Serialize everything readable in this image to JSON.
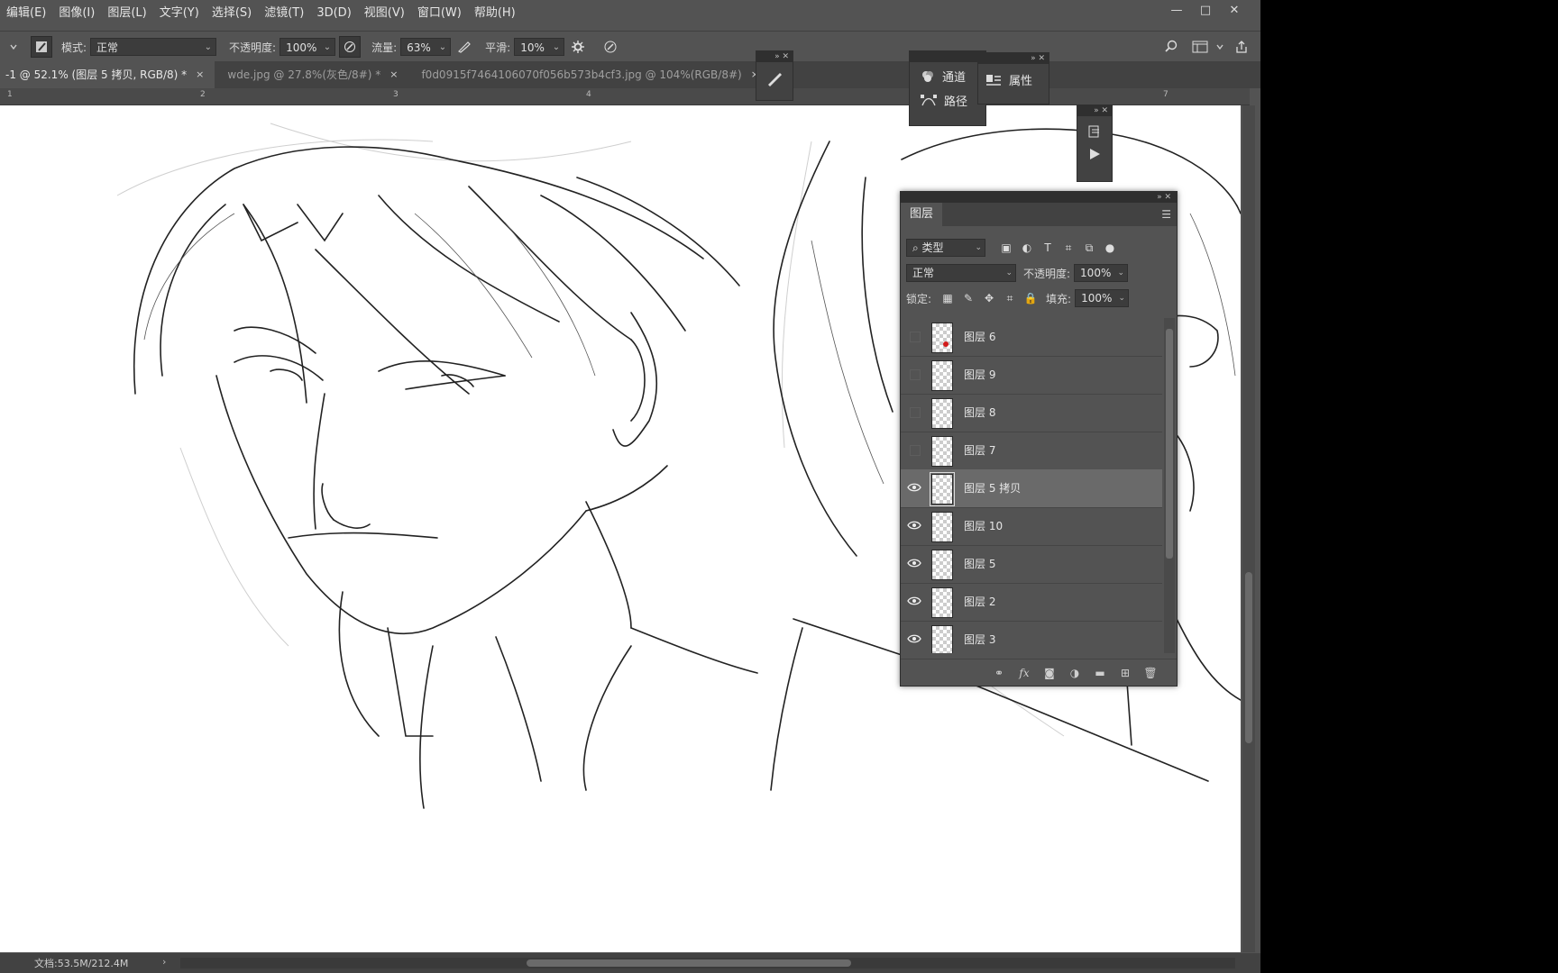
{
  "menu": [
    "编辑(E)",
    "图像(I)",
    "图层(L)",
    "文字(Y)",
    "选择(S)",
    "滤镜(T)",
    "3D(D)",
    "视图(V)",
    "窗口(W)",
    "帮助(H)"
  ],
  "window": {
    "minimize": "—",
    "maximize": "□",
    "close": "✕"
  },
  "options": {
    "mode_label": "模式:",
    "mode_value": "正常",
    "opacity_label": "不透明度:",
    "opacity_value": "100%",
    "flow_label": "流量:",
    "flow_value": "63%",
    "smooth_label": "平滑:",
    "smooth_value": "10%"
  },
  "tabs": [
    {
      "label": "-1 @ 52.1% (图层 5 拷贝, RGB/8) *",
      "active": true
    },
    {
      "label": "wde.jpg @ 27.8%(灰色/8#) *",
      "active": false
    },
    {
      "label": "f0d0915f7464106070f056b573b4cf3.jpg @ 104%(RGB/8#)",
      "active": false
    }
  ],
  "ruler_ticks": [
    "1",
    "2",
    "3",
    "4",
    "7"
  ],
  "channels_panel": {
    "channels_label": "通道",
    "paths_label": "路径",
    "properties_label": "属性"
  },
  "layers_panel": {
    "tab_label": "图层",
    "filter_kind": "类型",
    "blend_mode": "正常",
    "opacity_label": "不透明度:",
    "opacity_value": "100%",
    "lock_label": "锁定:",
    "fill_label": "填充:",
    "fill_value": "100%",
    "layers": [
      {
        "name": "图层 6",
        "visible": false,
        "selected": false,
        "has_red_mark": true
      },
      {
        "name": "图层 9",
        "visible": false,
        "selected": false,
        "has_red_mark": false
      },
      {
        "name": "图层 8",
        "visible": false,
        "selected": false,
        "has_red_mark": false
      },
      {
        "name": "图层 7",
        "visible": false,
        "selected": false,
        "has_red_mark": false
      },
      {
        "name": "图层 5 拷贝",
        "visible": true,
        "selected": true,
        "has_red_mark": false
      },
      {
        "name": "图层 10",
        "visible": true,
        "selected": false,
        "has_red_mark": false
      },
      {
        "name": "图层 5",
        "visible": true,
        "selected": false,
        "has_red_mark": false
      },
      {
        "name": "图层 2",
        "visible": true,
        "selected": false,
        "has_red_mark": false
      },
      {
        "name": "图层 3",
        "visible": true,
        "selected": false,
        "has_red_mark": false
      }
    ]
  },
  "status": {
    "doc_info": "文档:53.5M/212.4M",
    "arrow": "›"
  }
}
